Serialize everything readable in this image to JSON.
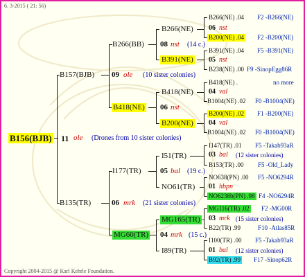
{
  "header": {
    "date_time": "6. 3-2015 ( 21: 56)"
  },
  "footer": {
    "copyright": "Copyright 2004-2015 @ Karl Kehrle Foundation."
  },
  "root": {
    "id": "B156(BJB)",
    "gen_num": "11",
    "gen_mark": "ole",
    "note": "(Drones from 10 sister colonies)"
  },
  "gen1": {
    "upper": {
      "id": "B157(BJB)",
      "num": "09",
      "mark": "ole",
      "note": "(10 sister colonies)"
    },
    "lower": {
      "id": "B135(TR)",
      "num": "06",
      "mark": "mrk",
      "note": "(21 sister colonies)"
    }
  },
  "gen2": {
    "a": {
      "id": "B266(BB)",
      "num": "08",
      "mark": "nst",
      "note": "(14 c.)"
    },
    "b": {
      "id": "B418(NE)",
      "num": "06",
      "mark": "nst"
    },
    "c": {
      "id": "I177(TR)",
      "num": "05",
      "mark": "bal",
      "note": "(19 c.)"
    },
    "d": {
      "id": "MG60(TR)",
      "num": "04",
      "mark": "mrk",
      "note": "(15 c.)"
    }
  },
  "gen3": {
    "a1": {
      "id": "B266(NE)"
    },
    "a2": {
      "id": "B391(NE)"
    },
    "b1": {
      "id": "B418(NE)"
    },
    "b2": {
      "id": "B200(NE)"
    },
    "c1": {
      "id": "I51(TR)"
    },
    "c2": {
      "id": "NO61(TR)"
    },
    "d1": {
      "id": "MG165(TR)"
    },
    "d2": {
      "id": "I89(TR)"
    }
  },
  "gen4": [
    {
      "left": "B266(NE) .04",
      "right": "F2 -B266(NE)"
    },
    {
      "left": "06",
      "mark": "nst"
    },
    {
      "left": "B200(NE) .04",
      "right": "F2 -B200(NE)"
    },
    {
      "left": "B391(NE) .04",
      "right": "F5 -B391(NE)"
    },
    {
      "left": "05",
      "mark": "nst"
    },
    {
      "left": "B238(NE) .00",
      "right": "F9 -SinopEgg86R"
    },
    {
      "left": "B418(NE) .",
      "right": "no more"
    },
    {
      "left": "04",
      "mark": "val"
    },
    {
      "left": "B1004(NE) .02",
      "right": "F0 -B1004(NE)"
    },
    {
      "left": "B200(NE) .02",
      "right": "F1 -B200(NE)"
    },
    {
      "left": "04",
      "mark": "val"
    },
    {
      "left": "B1004(NE) .02",
      "right": "F0 -B1004(NE)"
    },
    {
      "left": "I147(TR) .01",
      "right": "F5 -Takab93aR"
    },
    {
      "left": "03",
      "mark": "bal",
      "note": "(12 sister colonies)"
    },
    {
      "left": "B153(TR) .00",
      "right": "F5 -Old_Lady"
    },
    {
      "left": "NO638(PN) .00",
      "right": "F5 -NO6294R"
    },
    {
      "left": "01",
      "mark": "hbpn"
    },
    {
      "left": "NO6238b(PN) .98",
      "right": "F4 -NO6294R"
    },
    {
      "left": "MG116(TR) .02",
      "right": "F2 -MG00R"
    },
    {
      "left": "03",
      "mark": "mrk",
      "note": "(15 sister colonies)"
    },
    {
      "left": "B22(TR) .99",
      "right": "F10 -Atlas85R"
    },
    {
      "left": "I100(TR) .00",
      "right": "F5 -Takab93aR"
    },
    {
      "left": "01",
      "mark": "bal",
      "note": "(12 sister colonies)"
    },
    {
      "left": "B92(TR) .99",
      "right": "F17 -Sinop62R"
    }
  ]
}
